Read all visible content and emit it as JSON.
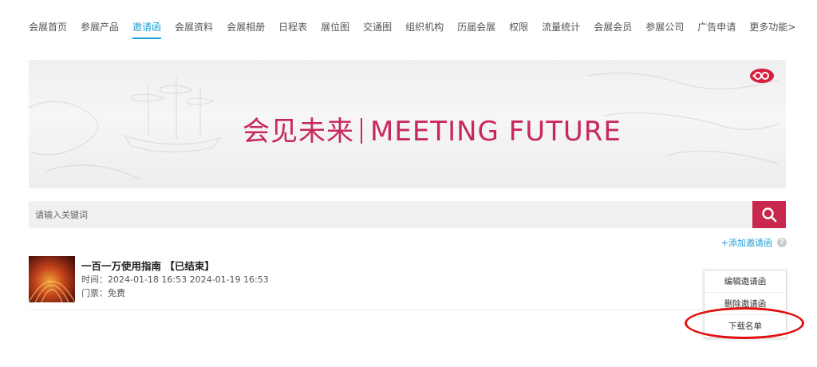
{
  "nav": {
    "items": [
      "会展首页",
      "参展产品",
      "邀请函",
      "会展资料",
      "会展相册",
      "日程表",
      "展位图",
      "交通图",
      "组织机构",
      "历届会展",
      "权限",
      "流量统计",
      "会展会员",
      "参展公司",
      "广告申请",
      "更多功能>"
    ],
    "active_index": 2
  },
  "banner": {
    "title_cn": "会见未来",
    "title_en": "MEETING FUTURE",
    "accent_color": "#c8285a"
  },
  "search": {
    "placeholder": "请输入关键词",
    "button_icon": "search-icon",
    "button_color": "#c8284e"
  },
  "add_link": {
    "label": "+添加邀请函",
    "help_icon": "question-icon"
  },
  "invitations": [
    {
      "title": "一百一万使用指南 【已结束】",
      "time": "时间：2024-01-18 16:53 2024-01-19 16:53",
      "ticket": "门票：免费"
    }
  ],
  "menu": {
    "edit": "编辑邀请函",
    "delete": "删除邀请函",
    "download": "下载名单"
  },
  "colors": {
    "link": "#1a9ed6",
    "highlight": "#e01010"
  }
}
